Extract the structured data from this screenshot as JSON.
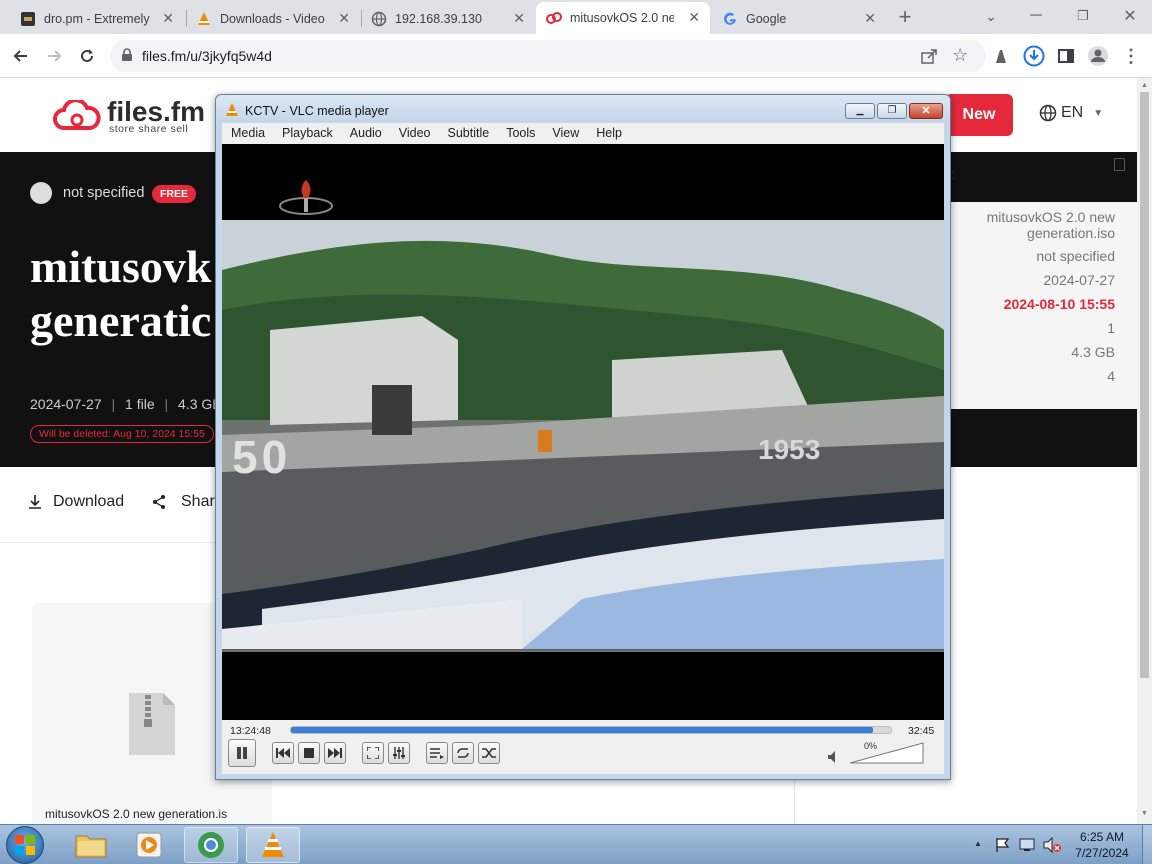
{
  "browser": {
    "tabs": [
      {
        "title": "dro.pm - Extremely",
        "active": false
      },
      {
        "title": "Downloads - Video",
        "active": false
      },
      {
        "title": "192.168.39.130",
        "active": false
      },
      {
        "title": "mitusovkOS 2.0 new",
        "active": true
      },
      {
        "title": "Google",
        "active": false
      }
    ],
    "close_glyph": "✕",
    "url": "files.fm/u/3jkyfq5w4d"
  },
  "site": {
    "logo_text": "files.fm",
    "logo_tagline": "store share sell",
    "new_button": "New",
    "language": "EN",
    "owner": "not specified",
    "owner_badge": "FREE",
    "title_line1": "mitusovk",
    "title_line2": "generatic",
    "meta_date": "2024-07-27",
    "meta_files": "1 file",
    "meta_size": "4.3 GB",
    "delete_notice": "Will be deleted: Aug 10, 2024 15:55",
    "download_label": "Download",
    "share_label": "Shar",
    "file_caption": "mitusovkOS 2.0 new generation.is",
    "side_colon": ":",
    "details": {
      "name_line1": "mitusovkOS 2.0 new",
      "name_line2": "generation.iso",
      "owner": "not specified",
      "uploaded": "2024-07-27",
      "expires": "2024-08-10 15:55",
      "files": "1",
      "size": "4.3 GB",
      "downloads": "4"
    }
  },
  "vlc": {
    "title": "KCTV - VLC media player",
    "menu": [
      "Media",
      "Playback",
      "Audio",
      "Video",
      "Subtitle",
      "Tools",
      "View",
      "Help"
    ],
    "time_elapsed": "13:24:48",
    "time_remaining": "32:45",
    "progress": 0.97,
    "volume_label": "0%",
    "video_text_left": "50",
    "video_text_right": "1953"
  },
  "taskbar": {
    "time": "6:25 AM",
    "date": "7/27/2024"
  },
  "colors": {
    "brand_red": "#e5283a",
    "vlc_progress": "#3b7dd8",
    "hero_bg": "#111111"
  }
}
